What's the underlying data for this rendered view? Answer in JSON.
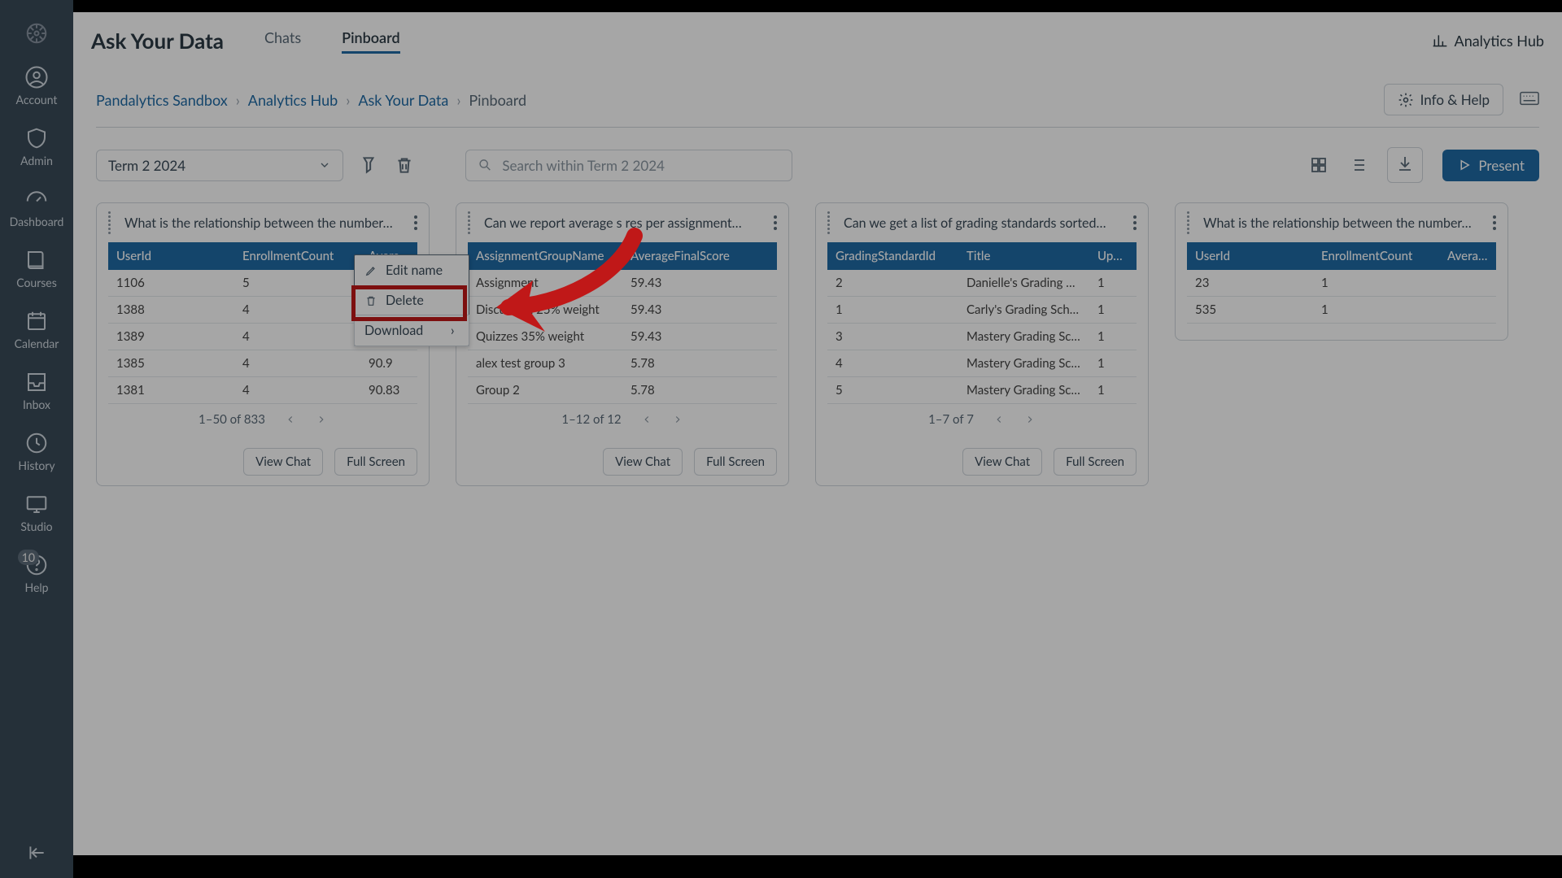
{
  "rail": {
    "items": [
      "Account",
      "Admin",
      "Dashboard",
      "Courses",
      "Calendar",
      "Inbox",
      "History",
      "Studio",
      "Help"
    ],
    "help_badge": "10"
  },
  "header": {
    "app_title": "Ask Your Data",
    "tab_chats": "Chats",
    "tab_pinboard": "Pinboard",
    "analytics_hub": "Analytics Hub"
  },
  "crumbs": {
    "a": "Pandalytics Sandbox",
    "b": "Analytics Hub",
    "c": "Ask Your Data",
    "d": "Pinboard"
  },
  "actions": {
    "info": "Info & Help",
    "present": "Present"
  },
  "toolbar": {
    "term": "Term 2 2024",
    "search_ph": "Search within Term 2 2024"
  },
  "menu": {
    "edit": "Edit name",
    "delete": "Delete",
    "download": "Download"
  },
  "card1": {
    "title": "What is the relationship between the number…",
    "cols": [
      "UserId",
      "EnrollmentCount",
      "Average"
    ],
    "rows": [
      [
        "1106",
        "5",
        ""
      ],
      [
        "1388",
        "4",
        ""
      ],
      [
        "1389",
        "4",
        ""
      ],
      [
        "1385",
        "4",
        "90.9"
      ],
      [
        "1381",
        "4",
        "90.83"
      ]
    ],
    "pager": "1–50 of 833"
  },
  "card2": {
    "title": "Can we report average s       res per assignment…",
    "cols": [
      "AssignmentGroupName",
      "AverageFinalScore"
    ],
    "rows": [
      [
        "Assignment",
        "59.43"
      ],
      [
        "Discussion 25% weight",
        "59.43"
      ],
      [
        "Quizzes 35% weight",
        "59.43"
      ],
      [
        "alex test group 3",
        "5.78"
      ],
      [
        "Group 2",
        "5.78"
      ]
    ],
    "pager": "1–12 of 12"
  },
  "card3": {
    "title": "Can we get a list of grading standards sorted…",
    "cols": [
      "GradingStandardId",
      "Title",
      "Update"
    ],
    "rows": [
      [
        "2",
        "Danielle's Grading Scheme",
        "1"
      ],
      [
        "1",
        "Carly's Grading Scheme",
        "1"
      ],
      [
        "3",
        "Mastery Grading Scheme",
        "1"
      ],
      [
        "4",
        "Mastery Grading Scheme",
        "1"
      ],
      [
        "5",
        "Mastery Grading Scheme",
        "1"
      ]
    ],
    "pager": "1–7 of 7"
  },
  "card4": {
    "title": "What is the relationship between the number…",
    "cols": [
      "UserId",
      "EnrollmentCount",
      "Average"
    ],
    "rows": [
      [
        "23",
        "1",
        ""
      ],
      [
        "535",
        "1",
        ""
      ]
    ]
  },
  "footer": {
    "view_chat": "View Chat",
    "full_screen": "Full Screen"
  }
}
